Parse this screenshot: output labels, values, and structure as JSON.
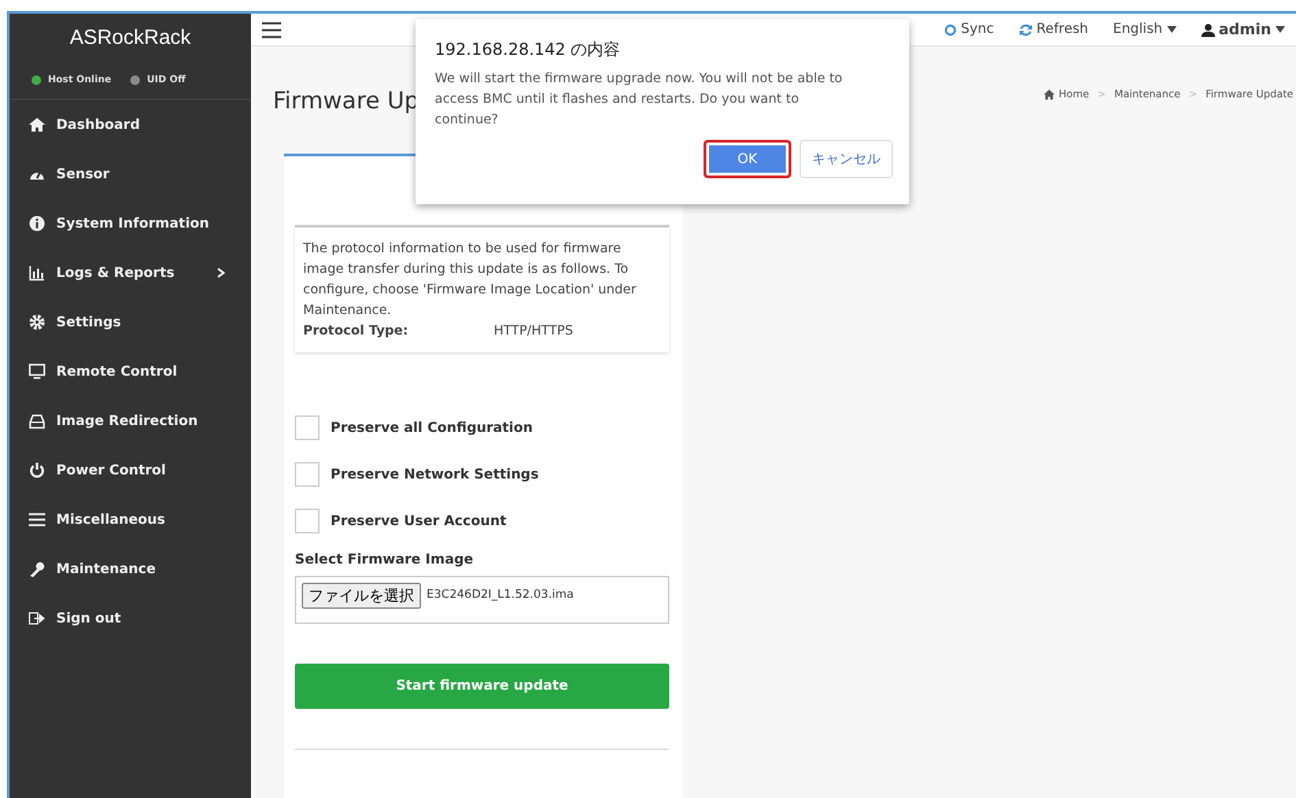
{
  "sidebar": {
    "logo": "ASRockRack",
    "status": [
      {
        "label": "Host Online",
        "color": "#3fae49"
      },
      {
        "label": "UID Off",
        "color": "#8a8a8a"
      }
    ],
    "items": [
      {
        "label": "Dashboard",
        "has_submenu": false
      },
      {
        "label": "Sensor",
        "has_submenu": false
      },
      {
        "label": "System Information",
        "has_submenu": false
      },
      {
        "label": "Logs & Reports",
        "has_submenu": true
      },
      {
        "label": "Settings",
        "has_submenu": false
      },
      {
        "label": "Remote Control",
        "has_submenu": false
      },
      {
        "label": "Image Redirection",
        "has_submenu": false
      },
      {
        "label": "Power Control",
        "has_submenu": false
      },
      {
        "label": "Miscellaneous",
        "has_submenu": false
      },
      {
        "label": "Maintenance",
        "has_submenu": false
      },
      {
        "label": "Sign out",
        "has_submenu": false
      }
    ]
  },
  "topbar": {
    "actions": [
      {
        "label": "Sync",
        "dropdown": false
      },
      {
        "label": "Refresh",
        "dropdown": false
      },
      {
        "label": "English",
        "dropdown": true
      },
      {
        "label": "admin",
        "dropdown": true
      }
    ]
  },
  "page": {
    "title": "Firmware Up",
    "breadcrumb": [
      "Home",
      "Maintenance",
      "Firmware Update"
    ],
    "breadcrumb_separators": [
      ">",
      ">"
    ],
    "info": {
      "text": "The protocol information to be used for firmware image transfer during this update is as follows. To configure, choose 'Firmware Image Location' under Maintenance.",
      "protocol_label": "Protocol Type:",
      "protocol_value": "HTTP/HTTPS"
    },
    "options": [
      {
        "label": "Preserve all Configuration",
        "checked": false
      },
      {
        "label": "Preserve Network Settings",
        "checked": false
      },
      {
        "label": "Preserve User Account",
        "checked": false
      }
    ],
    "file_label": "Select Firmware Image",
    "file_button": "ファイルを選択",
    "file_name": "E3C246D2I_L1.52.03.ima",
    "submit": "Start firmware update"
  },
  "dialog": {
    "title": "192.168.28.142 の内容",
    "message": "We will start the firmware upgrade now. You will not be able to access BMC until it flashes and restarts. Do you want to continue?",
    "buttons": [
      {
        "label": "OK",
        "kind": "primary",
        "focused": true
      },
      {
        "label": "キャンセル",
        "kind": "secondary",
        "focused": false
      }
    ]
  }
}
